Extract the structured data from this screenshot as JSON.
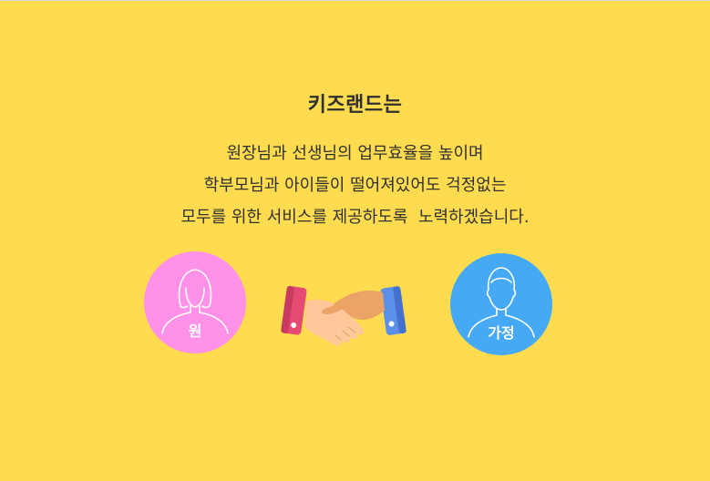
{
  "intro": {
    "title": "키즈랜드는",
    "lines": [
      "원장님과 선생님의 업무효율을 높이며",
      "학부모님과 아이들이 떨어져있어도 걱정없는",
      "모두를 위한 서비스를 제공하도록  노력하겠습니다."
    ]
  },
  "left_circle": {
    "label": "원",
    "color": "#FF92E8",
    "icon": "woman-silhouette-icon"
  },
  "center": {
    "icon": "handshake-icon"
  },
  "right_circle": {
    "label": "가정",
    "color": "#45A9F5",
    "icon": "man-silhouette-icon"
  },
  "colors": {
    "background": "#FFDC4F"
  }
}
